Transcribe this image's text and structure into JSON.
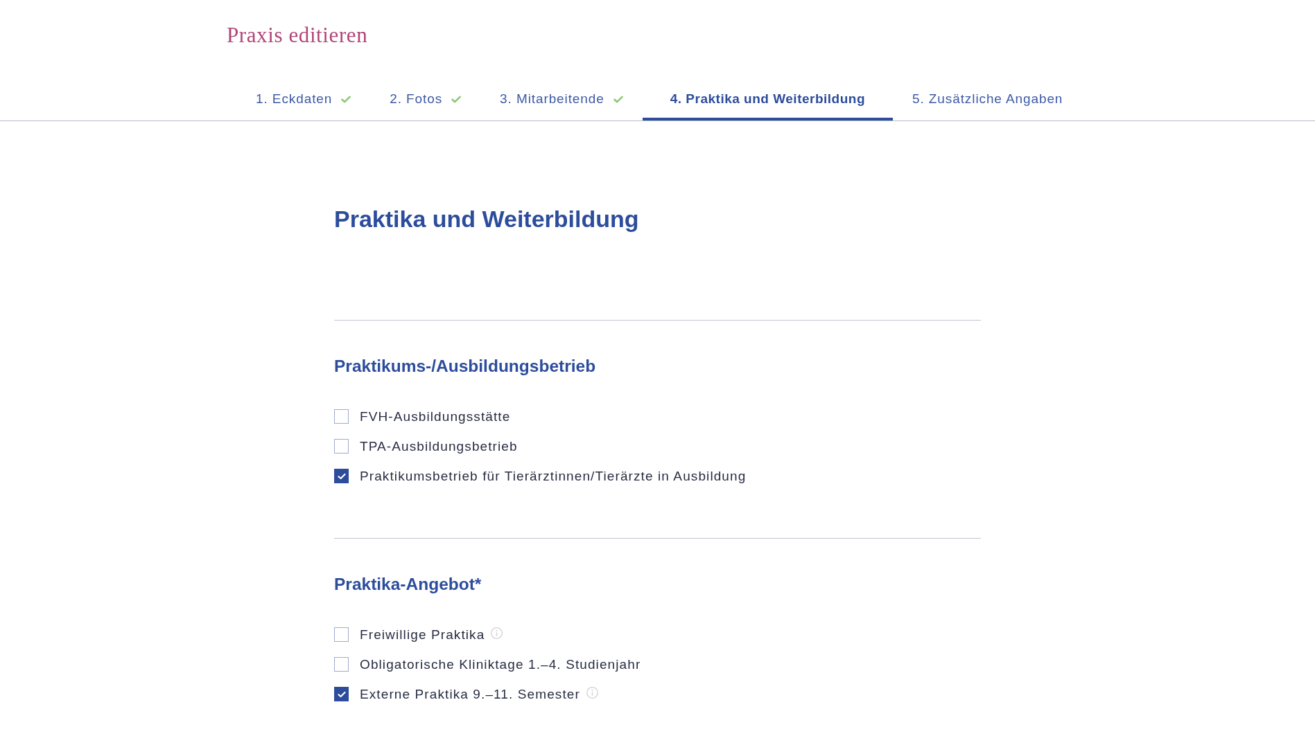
{
  "page_title": "Praxis editieren",
  "steps": [
    {
      "label": "1. Eckdaten",
      "completed": true,
      "selected": false
    },
    {
      "label": "2. Fotos",
      "completed": true,
      "selected": false
    },
    {
      "label": "3. Mitarbeitende",
      "completed": true,
      "selected": false
    },
    {
      "label": "4. Praktika und Weiterbildung",
      "completed": false,
      "selected": true
    },
    {
      "label": "5. Zusätzliche Angaben",
      "completed": false,
      "selected": false
    }
  ],
  "heading": "Praktika und Weiterbildung",
  "sections": [
    {
      "title": "Praktikums-/Ausbildungsbetrieb",
      "options": [
        {
          "label": "FVH-Ausbildungsstätte",
          "checked": false,
          "info": false
        },
        {
          "label": "TPA-Ausbildungsbetrieb",
          "checked": false,
          "info": false
        },
        {
          "label": "Praktikumsbetrieb für Tierärztinnen/Tierärzte in Ausbildung",
          "checked": true,
          "info": false
        }
      ]
    },
    {
      "title": "Praktika-Angebot*",
      "options": [
        {
          "label": "Freiwillige Praktika",
          "checked": false,
          "info": true
        },
        {
          "label": "Obligatorische Kliniktage 1.–4. Studienjahr",
          "checked": false,
          "info": false
        },
        {
          "label": "Externe Praktika 9.–11. Semester",
          "checked": true,
          "info": true
        }
      ]
    }
  ]
}
